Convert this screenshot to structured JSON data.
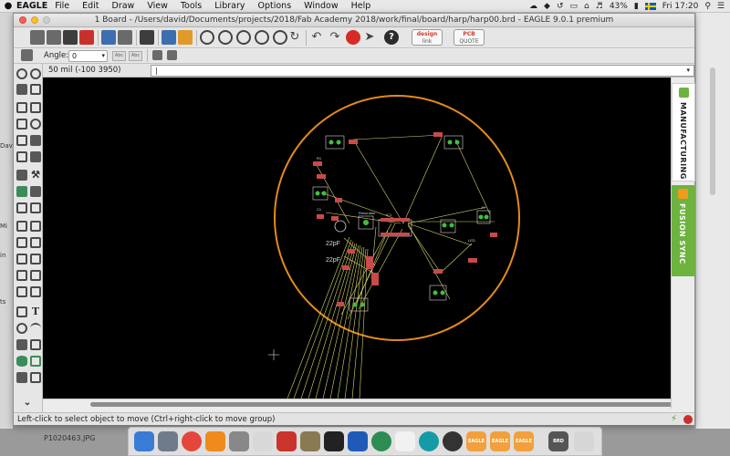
{
  "menubar": {
    "app_name": "EAGLE",
    "items": [
      "File",
      "Edit",
      "Draw",
      "View",
      "Tools",
      "Library",
      "Options",
      "Window",
      "Help"
    ],
    "battery": "43%",
    "clock": "Fri 17:20"
  },
  "background": {
    "left_fragments": [
      "Davi",
      "ts",
      "Mi",
      "in"
    ],
    "desktop_file": "P1020463.JPG"
  },
  "window": {
    "title": "1 Board - /Users/david/Documents/projects/2018/Fab Academy 2018/work/final/board/harp/harp00.brd - EAGLE 9.0.1 premium"
  },
  "toolbar": {
    "design_link_top": "design",
    "design_link_bottom": "link",
    "pcb_quote_top": "PCB",
    "pcb_quote_bottom": "QUOTE",
    "angle_label": "Angle:",
    "angle_value": "0"
  },
  "command": {
    "coordinate": "50 mil (-100 3950)",
    "input_value": "|"
  },
  "canvas": {
    "board_labels": [
      "22pF",
      "22pF",
      "Resonator",
      "R1",
      "C1",
      "IC1",
      "LED",
      "J1"
    ]
  },
  "side_panel": {
    "manufacturing": "MANUFACTURING",
    "fusion_sync": "FUSION SYNC"
  },
  "status": {
    "text": "Left-click to select object to move (Ctrl+right-click to move group)"
  },
  "dock": {
    "eagle_labels": [
      "EAGLE",
      "EAGLE",
      "EAGLE"
    ],
    "brd_label": "BRD"
  },
  "colors": {
    "board_outline": "#e38a1c",
    "airwire": "#d8d86a",
    "pad": "#c84a4a",
    "silkscreen": "#d8d8d8",
    "fusion_green": "#6db33f"
  }
}
